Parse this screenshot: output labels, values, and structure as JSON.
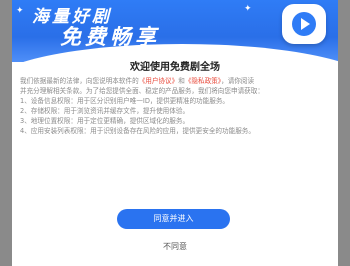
{
  "banner": {
    "line1": "海量好剧",
    "line2": "免费畅享"
  },
  "dialog": {
    "title": "欢迎使用免费剧全场",
    "intro_a": "我们依据最新的法律，向您说明本软件的",
    "user_agreement_link": "《用户协议》",
    "intro_and": "和",
    "privacy_policy_link": "《隐私政策》",
    "intro_b": "，请你阅读",
    "intro_line2": "并充分理解相关条款。为了给您提供全面、稳定的产品服务，我们将向您申请获取：",
    "permissions": [
      "1、设备信息权限：用于区分识别用户唯一ID，提供更精准的功能服务。",
      "2、存储权限：用于浏览资讯并缓存文件，提升使用体验。",
      "3、地理位置权限：用于定位更精确，提供区域化的服务。",
      "4、应用安装列表权限：用于识别设备存在风险的应用，提供更安全的功能服务。"
    ],
    "agree_button": "同意并进入",
    "disagree_button": "不同意"
  },
  "colors": {
    "accent": "#2a73f0",
    "link": "#e8493a",
    "banner_blue": "#2f7cf6"
  }
}
